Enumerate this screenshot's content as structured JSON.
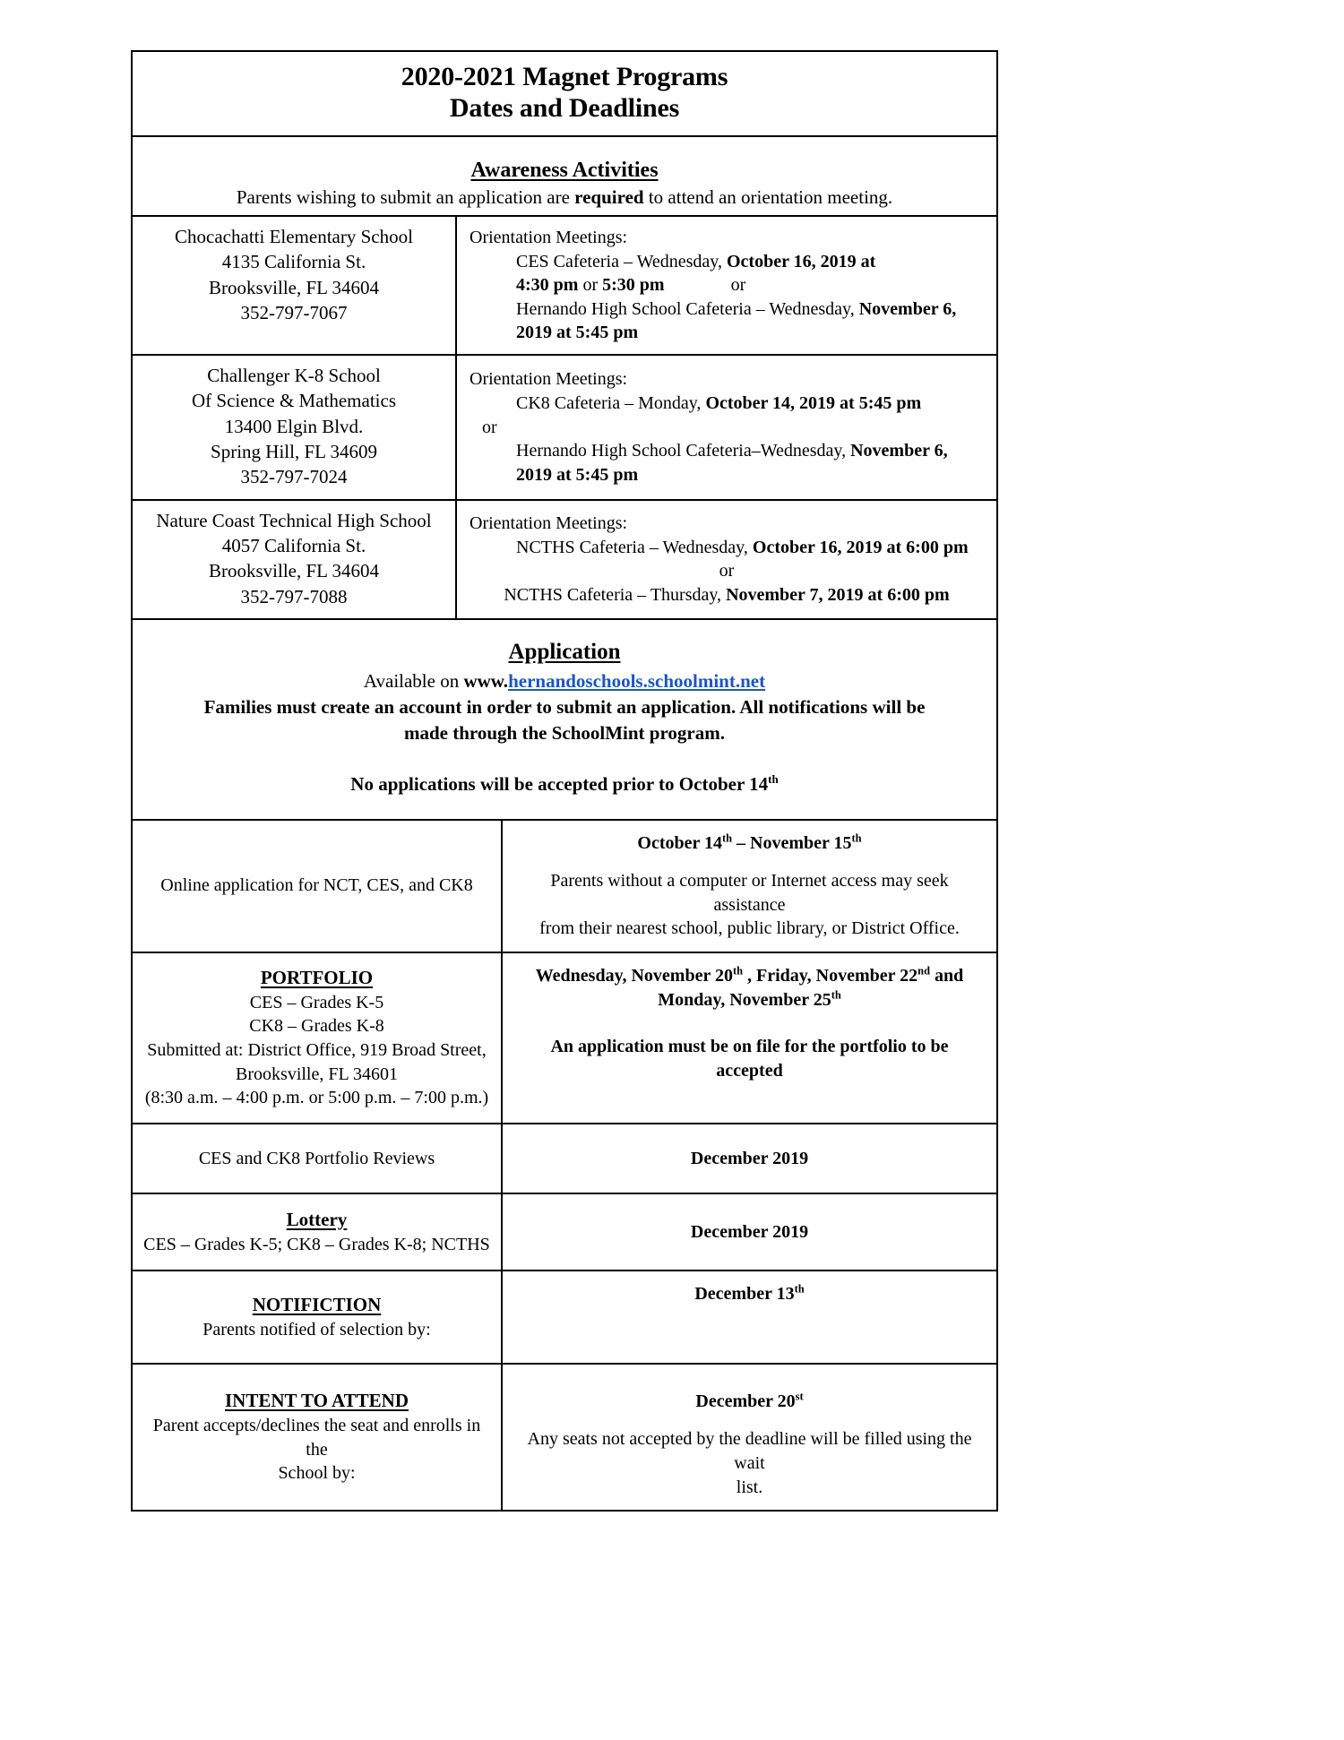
{
  "document": {
    "title_line1": "2020-2021 Magnet Programs",
    "title_line2": "Dates and Deadlines"
  },
  "awareness": {
    "heading": "Awareness Activities",
    "subtitle_before": "Parents wishing to submit an application are ",
    "subtitle_bold": "required",
    "subtitle_after": " to attend an orientation meeting.",
    "schools": [
      {
        "name": "Chocachatti Elementary School",
        "address": "4135 California St.",
        "city": "Brooksville, FL 34604",
        "phone": "352-797-7067",
        "meetings_label": "Orientation Meetings:",
        "line1_plain": "CES Cafeteria – Wednesday, ",
        "line1_bold": "October 16, 2019 at",
        "line2_bold_a": "4:30 pm",
        "line2_plain_a": " or ",
        "line2_bold_b": "5:30 pm",
        "line2_or": "or",
        "line3_plain": "Hernando High School Cafeteria – Wednesday, ",
        "line3_bold": "November 6,",
        "line4_bold": "2019 at 5:45 pm"
      },
      {
        "name": "Challenger K-8 School",
        "name2": "Of Science & Mathematics",
        "address": "13400 Elgin Blvd.",
        "city": "Spring Hill, FL 34609",
        "phone": "352-797-7024",
        "meetings_label": "Orientation Meetings:",
        "line1_plain": "CK8 Cafeteria – Monday, ",
        "line1_bold": "October 14, 2019 at 5:45 pm",
        "line2_or": "or",
        "line3_plain": "Hernando High School Cafeteria–Wednesday, ",
        "line3_bold": "November 6,",
        "line4_bold": "2019 at 5:45 pm"
      },
      {
        "name": "Nature Coast Technical High School",
        "address": "4057 California St.",
        "city": "Brooksville, FL 34604",
        "phone": "352-797-7088",
        "meetings_label": "Orientation Meetings:",
        "line1_plain": "NCTHS Cafeteria – Wednesday, ",
        "line1_bold": "October 16, 2019 at 6:00 pm",
        "line2_or": "or",
        "line3_plain": "NCTHS Cafeteria – Thursday, ",
        "line3_bold": "November 7, 2019 at 6:00 pm"
      }
    ]
  },
  "application": {
    "heading": "Application",
    "available_prefix": "Available on ",
    "available_www": "www.",
    "link_text": "hernandoschools.schoolmint.net",
    "link_color": "#1a56c4",
    "families_line1": "Families must create an account in order to submit an application. All notifications will be",
    "families_line2": "made through the SchoolMint program.",
    "no_apps_before": "No applications will be accepted prior to October 14",
    "no_apps_sup": "th"
  },
  "deadlines": [
    {
      "left_text": "Online application for NCT, CES, and CK8",
      "right_main_a": "October 14",
      "right_main_sup_a": "th",
      "right_main_b": " – November 15",
      "right_main_sup_b": "th",
      "right_note_line1": "Parents without a computer or Internet access may seek assistance",
      "right_note_line2": "from their nearest school, public library, or District Office."
    },
    {
      "left_heading": "PORTFOLIO",
      "left_line1": "CES – Grades K-5",
      "left_line2": "CK8 – Grades K-8",
      "left_line3": "Submitted at: District Office, 919 Broad Street,",
      "left_line4": "Brooksville, FL 34601",
      "left_line5": "(8:30 a.m. – 4:00 p.m. or 5:00 p.m. – 7:00 p.m.)",
      "right_line1_a": "Wednesday, November 20",
      "right_line1_sup": "th",
      "right_line1_b": " , Friday, November 22",
      "right_line1_sup_b": "nd",
      "right_line1_c": " and",
      "right_line2_a": "Monday, November  25",
      "right_line2_sup": "th",
      "right_note": "An application must be on file for the portfolio to be accepted"
    },
    {
      "left_text": "CES and CK8 Portfolio Reviews",
      "right_main": "December 2019"
    },
    {
      "left_heading": "Lottery",
      "left_sub": "CES – Grades K-5; CK8 – Grades K-8; NCTHS",
      "right_main": "December 2019"
    },
    {
      "left_heading": "NOTIFICTION",
      "left_sub": "Parents notified of selection by:",
      "right_main": "December 13",
      "right_main_sup": "th"
    },
    {
      "left_heading": "INTENT TO ATTEND",
      "left_sub_line1": "Parent accepts/declines the seat and enrolls in the",
      "left_sub_line2": "School by:",
      "right_main": "December 20",
      "right_main_sup": "st",
      "right_note_line1": "Any seats not accepted by the deadline will be filled using the wait",
      "right_note_line2": "list."
    }
  ]
}
